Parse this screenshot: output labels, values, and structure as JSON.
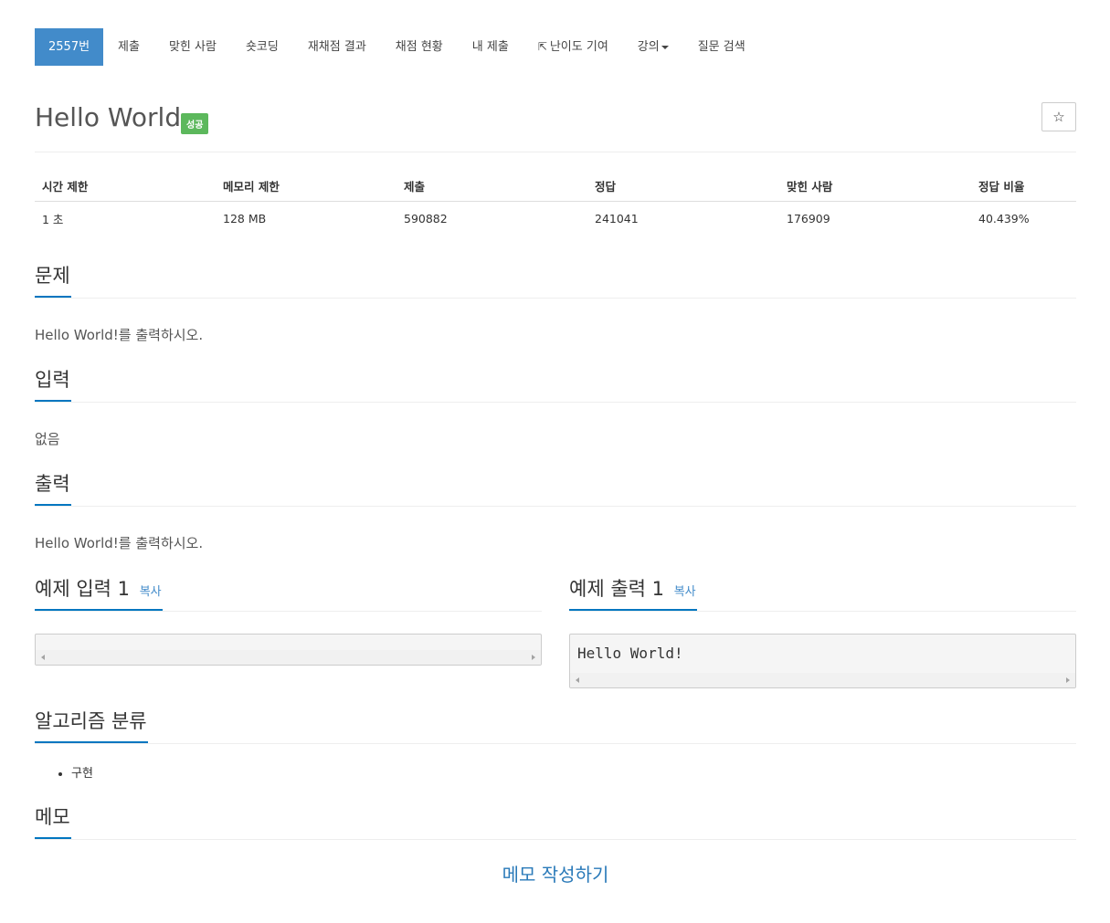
{
  "nav": {
    "items": [
      {
        "label": "2557번",
        "active": true
      },
      {
        "label": "제출"
      },
      {
        "label": "맞힌 사람"
      },
      {
        "label": "숏코딩"
      },
      {
        "label": "재채점 결과"
      },
      {
        "label": "채점 현황"
      },
      {
        "label": "내 제출"
      },
      {
        "label": "난이도 기여",
        "icon": "external-link-icon"
      },
      {
        "label": "강의",
        "icon": "caret-down-icon"
      },
      {
        "label": "질문 검색"
      }
    ]
  },
  "problem": {
    "title": "Hello World",
    "status_badge": "성공",
    "star_icon": "☆"
  },
  "info": {
    "headers": [
      "시간 제한",
      "메모리 제한",
      "제출",
      "정답",
      "맞힌 사람",
      "정답 비율"
    ],
    "values": [
      "1 초",
      "128 MB",
      "590882",
      "241041",
      "176909",
      "40.439%"
    ]
  },
  "sections": {
    "description": {
      "title": "문제",
      "text": "Hello World!를 출력하시오."
    },
    "input": {
      "title": "입력",
      "text": "없음"
    },
    "output": {
      "title": "출력",
      "text": "Hello World!를 출력하시오."
    },
    "sample_input": {
      "title": "예제 입력 1",
      "copy_label": "복사",
      "content": ""
    },
    "sample_output": {
      "title": "예제 출력 1",
      "copy_label": "복사",
      "content": "Hello World!"
    },
    "tags": {
      "title": "알고리즘 분류",
      "items": [
        "구현"
      ]
    },
    "memo": {
      "title": "메모",
      "link_label": "메모 작성하기"
    }
  },
  "colors": {
    "active_tab": "#428bca",
    "badge_success": "#5cb85c",
    "section_underline": "#0076c0",
    "link": "#2a7ab9"
  }
}
